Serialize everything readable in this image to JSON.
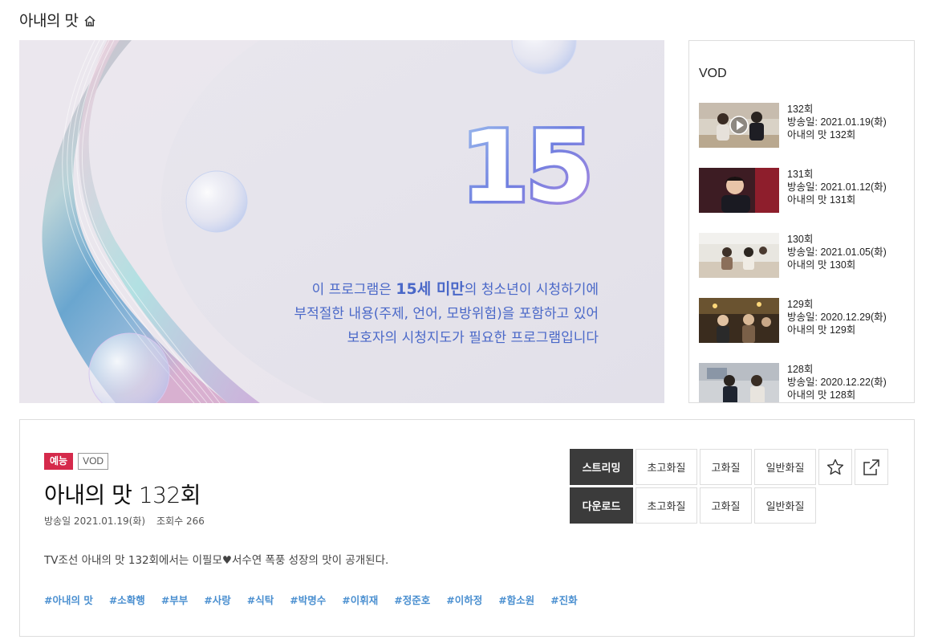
{
  "header": {
    "title": "아내의 맛"
  },
  "player": {
    "rating_number": "15",
    "notice_lines": [
      [
        "이 프로그램은 ",
        "15세 미만",
        "의 청소년이 시청하기에"
      ],
      [
        "부적절한 내용(주제, 언어, 모방위험)을 포함하고 있어"
      ],
      [
        "보호자의 시청지도가 필요한 프로그램입니다"
      ]
    ]
  },
  "vod": {
    "heading": "VOD",
    "items": [
      {
        "episode": "132회",
        "date": "방송일: 2021.01.19(화)",
        "title": "아내의 맛 132회",
        "playing": true
      },
      {
        "episode": "131회",
        "date": "방송일: 2021.01.12(화)",
        "title": "아내의 맛 131회",
        "playing": false
      },
      {
        "episode": "130회",
        "date": "방송일: 2021.01.05(화)",
        "title": "아내의 맛 130회",
        "playing": false
      },
      {
        "episode": "129회",
        "date": "방송일: 2020.12.29(화)",
        "title": "아내의 맛 129회",
        "playing": false
      },
      {
        "episode": "128회",
        "date": "방송일: 2020.12.22(화)",
        "title": "아내의 맛 128회",
        "playing": false
      }
    ]
  },
  "info": {
    "genre_badge": "예능",
    "type_badge": "VOD",
    "title": "아내의 맛 132회",
    "air_date": "방송일 2021.01.19(화)",
    "views": "조회수 266",
    "description": "TV조선 아내의 맛 132회에서는 이필모♥서수연 폭풍 성장의 맛이 공개된다.",
    "tags": [
      "#아내의 맛",
      "#소확행",
      "#부부",
      "#사랑",
      "#식탁",
      "#박명수",
      "#이휘재",
      "#정준호",
      "#이하정",
      "#함소원",
      "#진화"
    ]
  },
  "actions": {
    "stream_label": "스트리밍",
    "download_label": "다운로드",
    "quality_labels": [
      "초고화질",
      "고화질",
      "일반화질"
    ],
    "favorite_icon": "star-icon",
    "share_icon": "share-icon"
  },
  "colors": {
    "genre_badge": "#d52a4b",
    "tag": "#4a8fd0",
    "dark_button": "#3b3b3b",
    "notice_text": "#4a68c8"
  }
}
